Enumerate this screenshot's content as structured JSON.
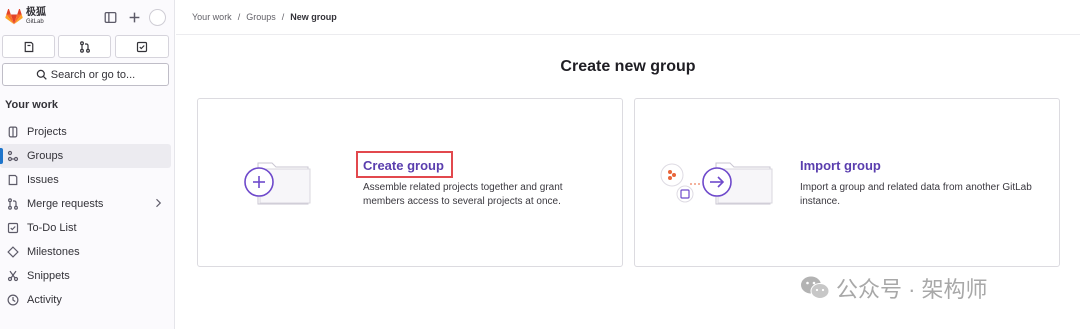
{
  "brand": {
    "name": "极狐",
    "sub": "GitLab"
  },
  "sidebar": {
    "search_label": "Search or go to...",
    "section_title": "Your work",
    "items": [
      {
        "label": "Projects",
        "icon": "project-icon"
      },
      {
        "label": "Groups",
        "icon": "group-icon",
        "active": true
      },
      {
        "label": "Issues",
        "icon": "issues-icon"
      },
      {
        "label": "Merge requests",
        "icon": "merge-request-icon"
      },
      {
        "label": "To-Do List",
        "icon": "todo-icon"
      },
      {
        "label": "Milestones",
        "icon": "milestone-icon"
      },
      {
        "label": "Snippets",
        "icon": "snippet-icon"
      },
      {
        "label": "Activity",
        "icon": "activity-icon"
      }
    ]
  },
  "breadcrumb": {
    "items": [
      "Your work",
      "Groups",
      "New group"
    ]
  },
  "main": {
    "title": "Create new group",
    "cards": [
      {
        "title": "Create group",
        "desc_line1": "Assemble related projects together and grant",
        "desc_line2": "members access to several projects at once."
      },
      {
        "title": "Import group",
        "desc_line1": "Import a group and related data from another GitLab",
        "desc_line2": "instance."
      }
    ]
  },
  "watermark": {
    "text": "公众号 · 架构师"
  },
  "colors": {
    "accent": "#5a3eae",
    "active_bar": "#1f75cb",
    "highlight": "#e2484d",
    "logo": "#e24329"
  }
}
